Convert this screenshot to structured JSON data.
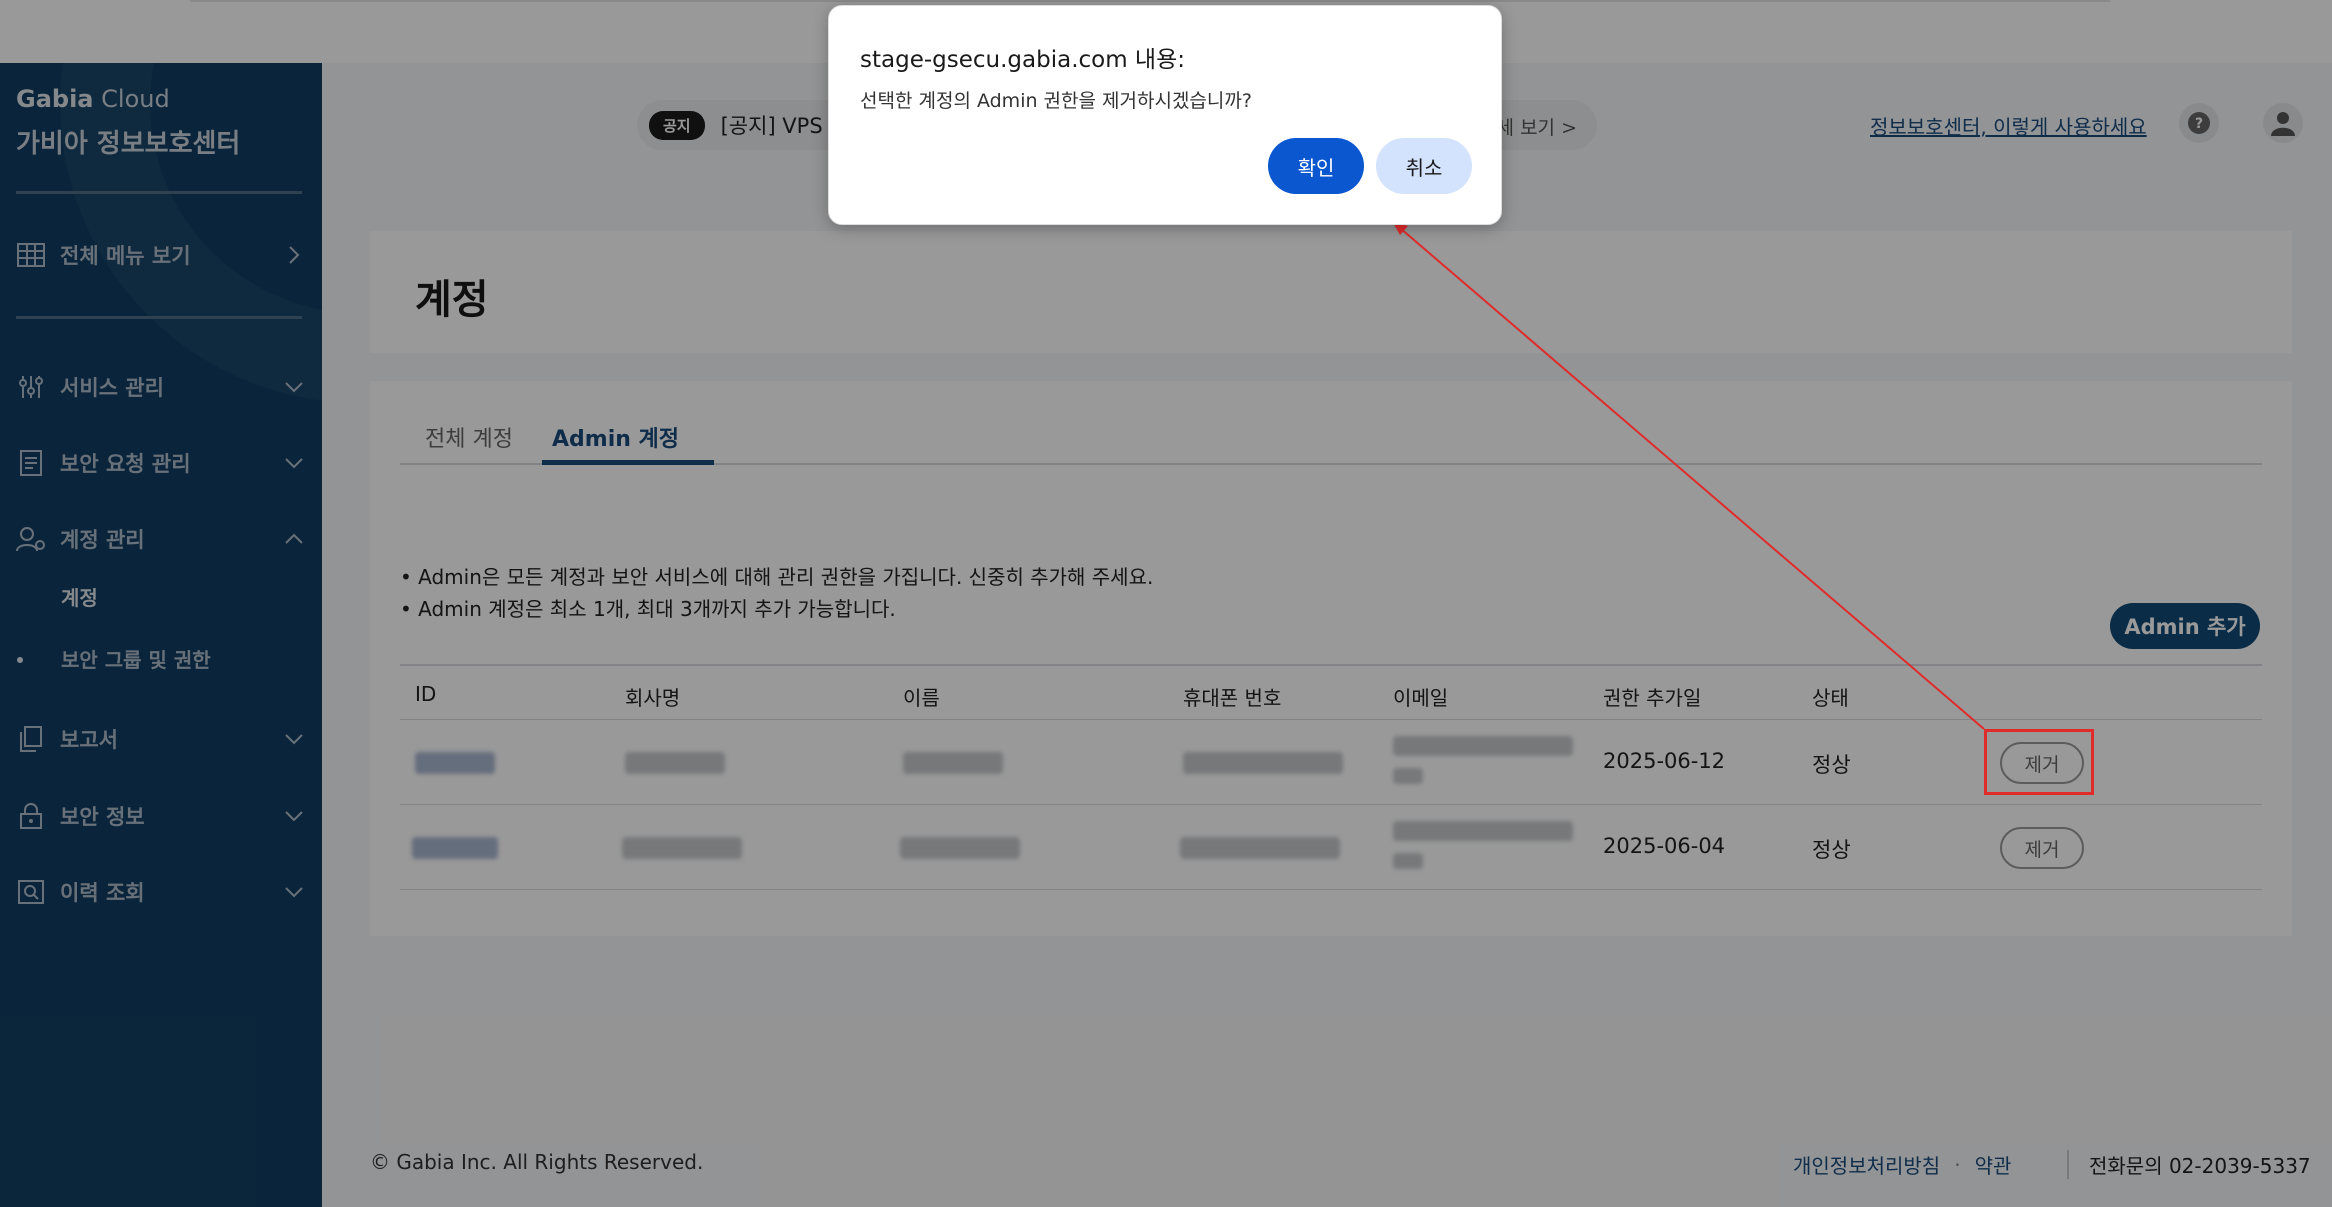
{
  "colors": {
    "sidebar_bg": "#123f63",
    "accent": "#1a4b7d",
    "dialog_ok": "#0b57d0",
    "dialog_cancel": "#d3e3fd",
    "annotation": "#e02b2b"
  },
  "sidebar": {
    "brand_primary": "Gabia",
    "brand_secondary": "Cloud",
    "brand_title": "가비아 정보보호센터",
    "all_menu": "전체 메뉴 보기",
    "items": [
      {
        "label": "서비스 관리",
        "icon": "sliders-icon"
      },
      {
        "label": "보안 요청 관리",
        "icon": "document-icon"
      },
      {
        "label": "계정 관리",
        "icon": "user-gear-icon"
      },
      {
        "label": "보고서",
        "icon": "copy-icon"
      },
      {
        "label": "보안 정보",
        "icon": "lock-icon"
      },
      {
        "label": "이력 조회",
        "icon": "search-doc-icon"
      }
    ],
    "sub_items": [
      "계정",
      "보안 그룹 및 권한"
    ]
  },
  "header": {
    "notice_badge": "공지",
    "notice_text": "[공지] VPS",
    "notice_more": "세 보기 >",
    "help_link": "정보보호센터, 이렇게 사용하세요"
  },
  "page": {
    "title": "계정",
    "tabs": [
      "전체 계정",
      "Admin 계정"
    ],
    "info": [
      "• Admin은 모든 계정과 보안 서비스에 대해 관리 권한을 가집니다. 신중히 추가해 주세요.",
      "• Admin 계정은 최소 1개, 최대 3개까지 추가 가능합니다."
    ],
    "add_button": "Admin 추가"
  },
  "table": {
    "columns": [
      "ID",
      "회사명",
      "이름",
      "휴대폰 번호",
      "이메일",
      "권한 추가일",
      "상태"
    ],
    "rows": [
      {
        "date": "2025-06-12",
        "status": "정상",
        "action": "제거"
      },
      {
        "date": "2025-06-04",
        "status": "정상",
        "action": "제거"
      }
    ]
  },
  "footer": {
    "copyright": "© Gabia Inc. All Rights Reserved.",
    "privacy": "개인정보처리방침",
    "separator": "·",
    "terms": "약관",
    "tel": "전화문의 02-2039-5337"
  },
  "dialog": {
    "title": "stage-gsecu.gabia.com 내용:",
    "message": "선택한 계정의 Admin 권한을 제거하시겠습니까?",
    "ok": "확인",
    "cancel": "취소"
  }
}
